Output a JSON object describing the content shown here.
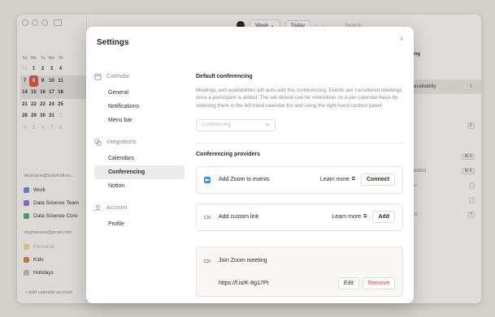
{
  "app": {
    "top": {
      "view": "Week",
      "view_caret": "⌄",
      "today": "Today",
      "prev": "‹",
      "next": "›",
      "search_placeholder": "Search"
    },
    "mini_calendar": {
      "weekdays": [
        "Su",
        "Mo",
        "Tu",
        "We",
        "Th",
        "",
        ""
      ],
      "rows": [
        [
          "31",
          "1",
          "2",
          "3",
          "4",
          "",
          ""
        ],
        [
          "7",
          "8",
          "9",
          "10",
          "11",
          "",
          ""
        ],
        [
          "14",
          "15",
          "16",
          "17",
          "18",
          "",
          ""
        ],
        [
          "21",
          "22",
          "23",
          "24",
          "25",
          "",
          ""
        ],
        [
          "28",
          "29",
          "30",
          "31",
          "1",
          "",
          ""
        ],
        [
          "4",
          "5",
          "6",
          "7",
          "8",
          "",
          ""
        ]
      ]
    },
    "accounts": [
      {
        "email": "stephanie@toolsforthou...",
        "calendars": [
          {
            "name": "Work",
            "color": "#5b8def"
          },
          {
            "name": "Data Science Team",
            "color": "#8c6fe0"
          },
          {
            "name": "Data Science Core",
            "color": "#4dab6a"
          }
        ]
      },
      {
        "email": "stephaeeee@gmail.com",
        "calendars": [
          {
            "name": "Personal",
            "color": "#f3d37a",
            "faded": true
          },
          {
            "name": "Kids",
            "color": "#e87b3e"
          },
          {
            "name": "Holidays",
            "color": "#bdbbb7"
          }
        ]
      }
    ],
    "add_account": "+ Add calendar account",
    "right_panel": {
      "heading": "ting",
      "availability": "availability",
      "rows": [
        {
          "label": "",
          "kbd": "S"
        },
        {
          "label": "",
          "kbd": "F"
        },
        {
          "label": "",
          "kbd": "⌘ K"
        },
        {
          "label": "control",
          "kbd": "⌘ K"
        },
        {
          "label": "nu",
          "kbd": ""
        },
        {
          "label": "",
          "kbd": ""
        },
        {
          "label": "uts",
          "kbd": "?"
        }
      ]
    }
  },
  "modal": {
    "title": "Settings",
    "close": "×",
    "nav": {
      "calendar_section": "Calendar",
      "calendar_items": [
        "General",
        "Notifications",
        "Menu bar"
      ],
      "integrations_section": "Integrations",
      "integrations_items": [
        "Calendars",
        "Conferencing",
        "Notion"
      ],
      "account_section": "Account",
      "account_items": [
        "Profile"
      ],
      "active": "Conferencing"
    },
    "content": {
      "default_title": "Default conferencing",
      "default_desc": "Meetings and availabilities will auto-add this conferencing. Events are considered meetings once a participant is added. The set default can be overridden on a per-calendar basis by selecting them in the left-hand calendar list and using the right-hand context panel.",
      "select_placeholder": "Conferencing",
      "providers_title": "Conferencing providers",
      "providers": [
        {
          "label": "Add Zoom to events",
          "learn_more": "Learn more",
          "action": "Connect"
        },
        {
          "label": "Add custom link",
          "learn_more": "Learn more",
          "action": "Add"
        }
      ],
      "zoom_meeting": {
        "label": "Join Zoom meeting",
        "url": "https://f.io/K-8g17Pt",
        "edit": "Edit",
        "remove": "Remove"
      }
    }
  },
  "colors": {
    "accent": "#2d8cff",
    "danger": "#d6453d",
    "today": "#dd5743"
  }
}
